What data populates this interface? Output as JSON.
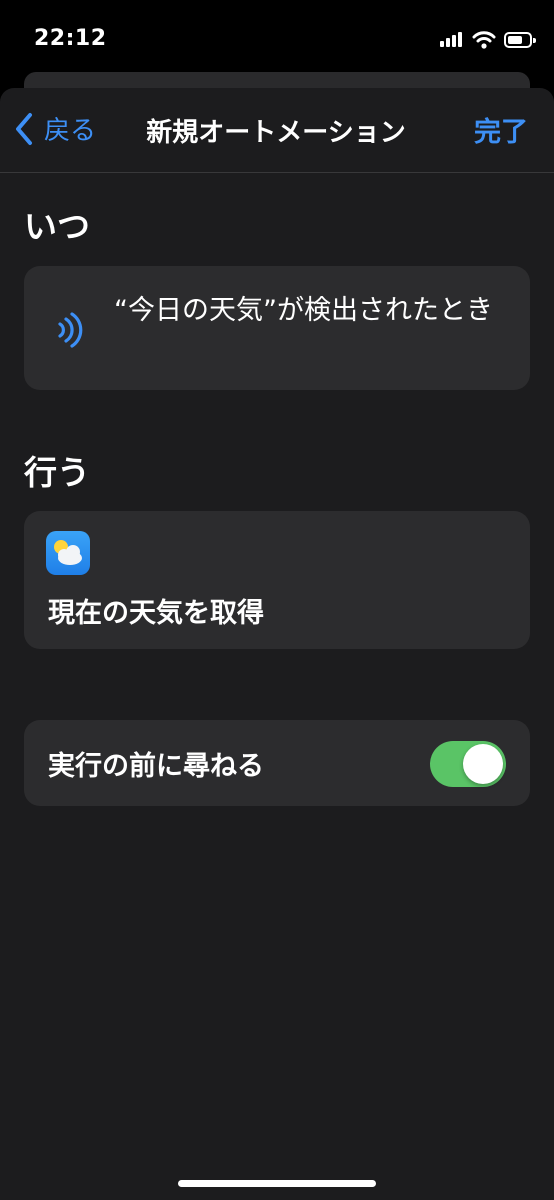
{
  "status_bar": {
    "time": "22:12"
  },
  "nav": {
    "back_label": "戻る",
    "title": "新規オートメーション",
    "done_label": "完了"
  },
  "when": {
    "section_title": "いつ",
    "trigger_text": "“今日の天気”が検出されたとき",
    "icon": "nfc-icon"
  },
  "do": {
    "section_title": "行う",
    "action_icon": "weather-app-icon",
    "action_text": "現在の天気を取得"
  },
  "ask": {
    "label": "実行の前に尋ねる",
    "enabled": true
  },
  "colors": {
    "accent": "#3d8ff5",
    "toggle_on": "#5ac466",
    "card": "#2c2c2e",
    "sheet": "#1c1c1e"
  }
}
